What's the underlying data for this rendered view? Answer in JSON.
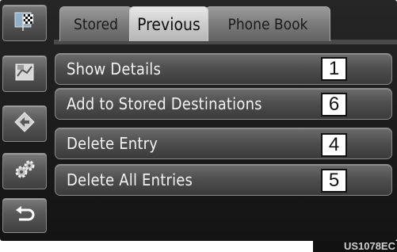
{
  "tabs": [
    {
      "label": "Stored",
      "active": false
    },
    {
      "label": "Previous",
      "active": true
    },
    {
      "label": "Phone Book",
      "active": false
    }
  ],
  "sidebar": {
    "items": [
      {
        "icon": "destination-flag-icon"
      },
      {
        "icon": "map-route-icon"
      },
      {
        "icon": "navigation-arrow-icon"
      },
      {
        "icon": "settings-gear-icon"
      },
      {
        "icon": "back-arrow-icon"
      }
    ]
  },
  "menu": {
    "items": [
      {
        "label": "Show Details",
        "callout": "1"
      },
      {
        "label": "Add to Stored Destinations",
        "callout": "6"
      },
      {
        "label": "Delete Entry",
        "callout": "4"
      },
      {
        "label": "Delete All Entries",
        "callout": "5"
      }
    ]
  },
  "figure_code": "US1078EC",
  "colors": {
    "screen_bg": "#1e1e1e",
    "row": "#505050",
    "active_tab": "#d0d0d0"
  }
}
